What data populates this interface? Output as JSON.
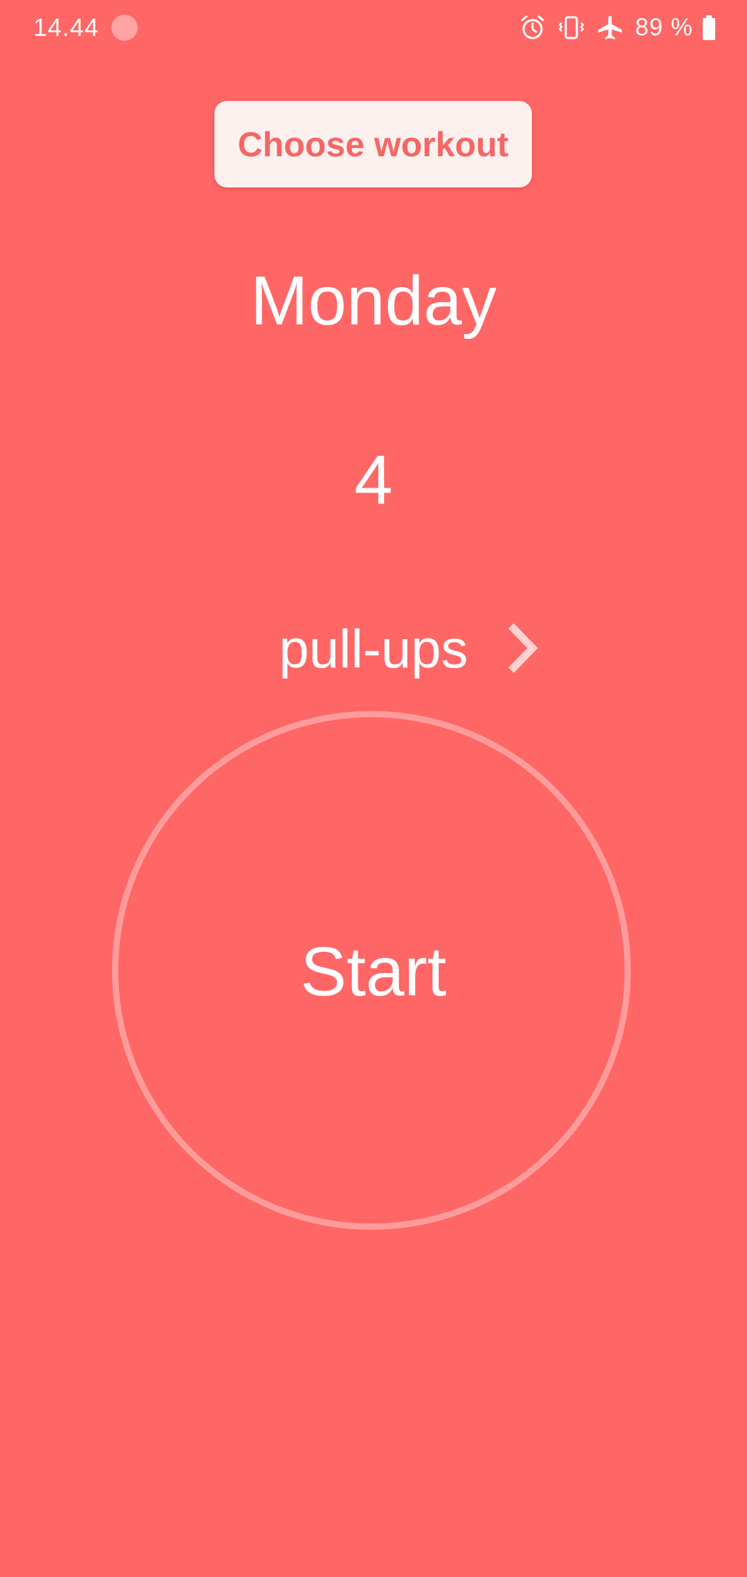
{
  "status_bar": {
    "time": "14.44",
    "battery_text": "89 %",
    "icons": [
      "alarm-icon",
      "vibrate-icon",
      "airplane-mode-icon",
      "battery-icon"
    ]
  },
  "header": {
    "choose_workout_label": "Choose workout"
  },
  "workout": {
    "day": "Monday",
    "count": "4",
    "exercise": "pull-ups",
    "next_icon": "chevron-right-icon"
  },
  "start": {
    "label": "Start"
  },
  "colors": {
    "background": "#ff6666",
    "button_bg": "#fdf1f0",
    "button_text": "#f46765",
    "ring": "#ff9b9b",
    "text": "#ffffff"
  }
}
